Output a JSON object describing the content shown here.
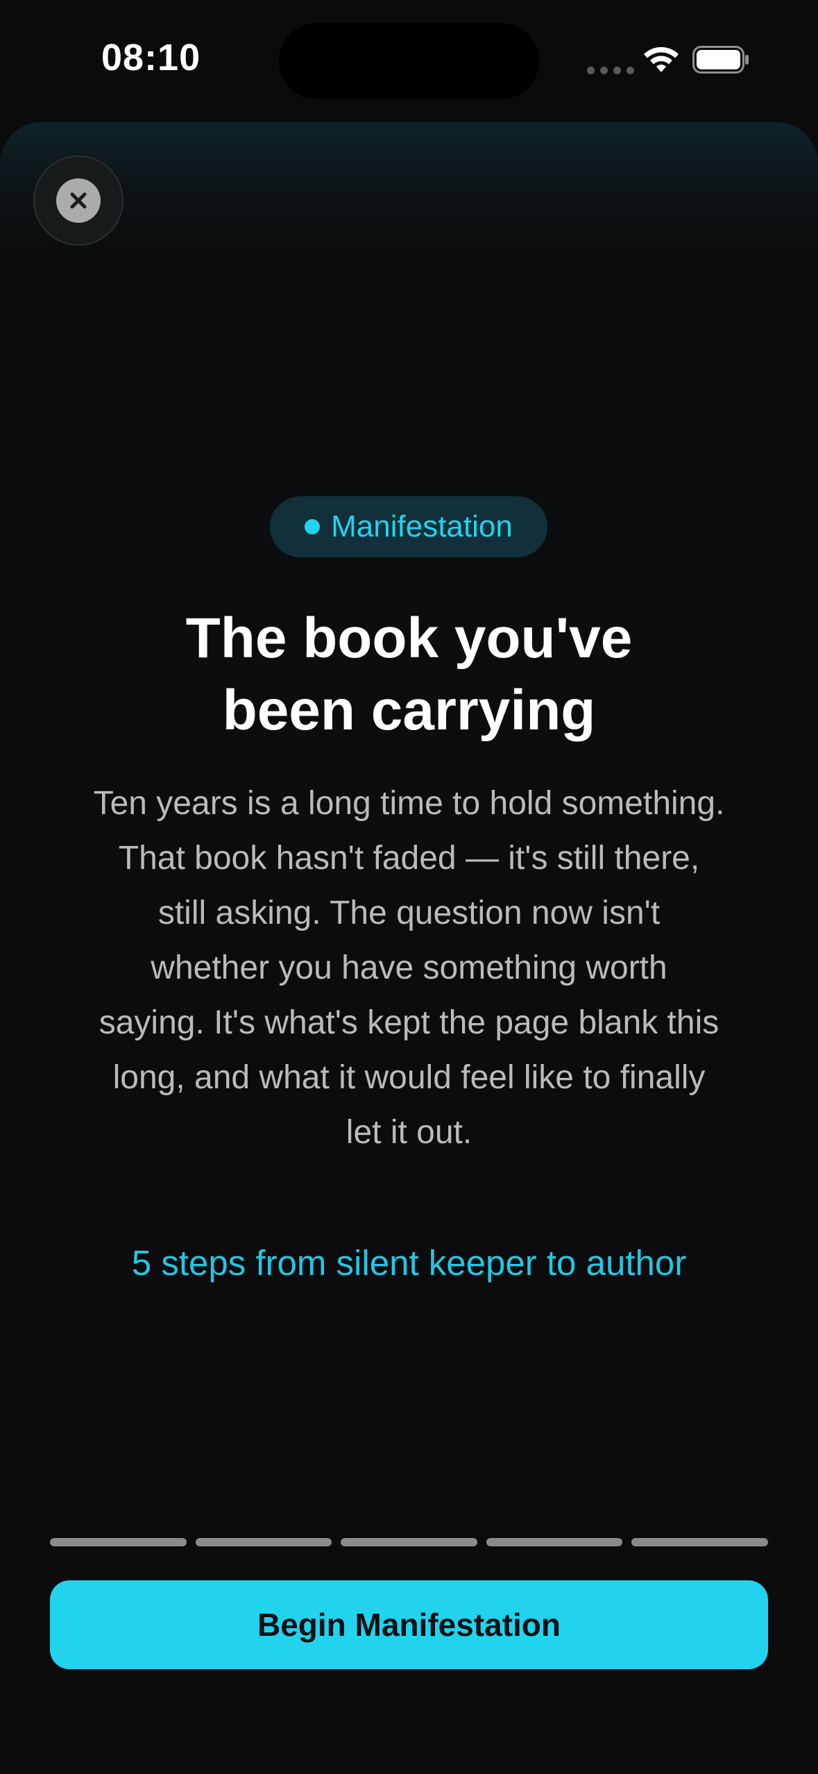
{
  "status_bar": {
    "time": "08:10",
    "icons": [
      "signal-dots-icon",
      "wifi-icon",
      "battery-icon"
    ]
  },
  "sheet": {
    "close_icon": "close-icon",
    "chip": {
      "label": "Manifestation",
      "color": "#22d3ee"
    },
    "title_line1": "The book you've",
    "title_line2": "been carrying",
    "body_lines": [
      "Ten years is a long time to hold something.",
      "That book hasn't faded — it's still there,",
      "still asking. The question now isn't",
      "whether you have something worth",
      "saying. It's what's kept the page blank this",
      "long, and what it would feel like to finally",
      "let it out."
    ],
    "steps_link": "5 steps from silent keeper to author",
    "progress_total_steps": 5,
    "cta_label": "Begin Manifestation",
    "accent_color": "#22d3ee"
  }
}
